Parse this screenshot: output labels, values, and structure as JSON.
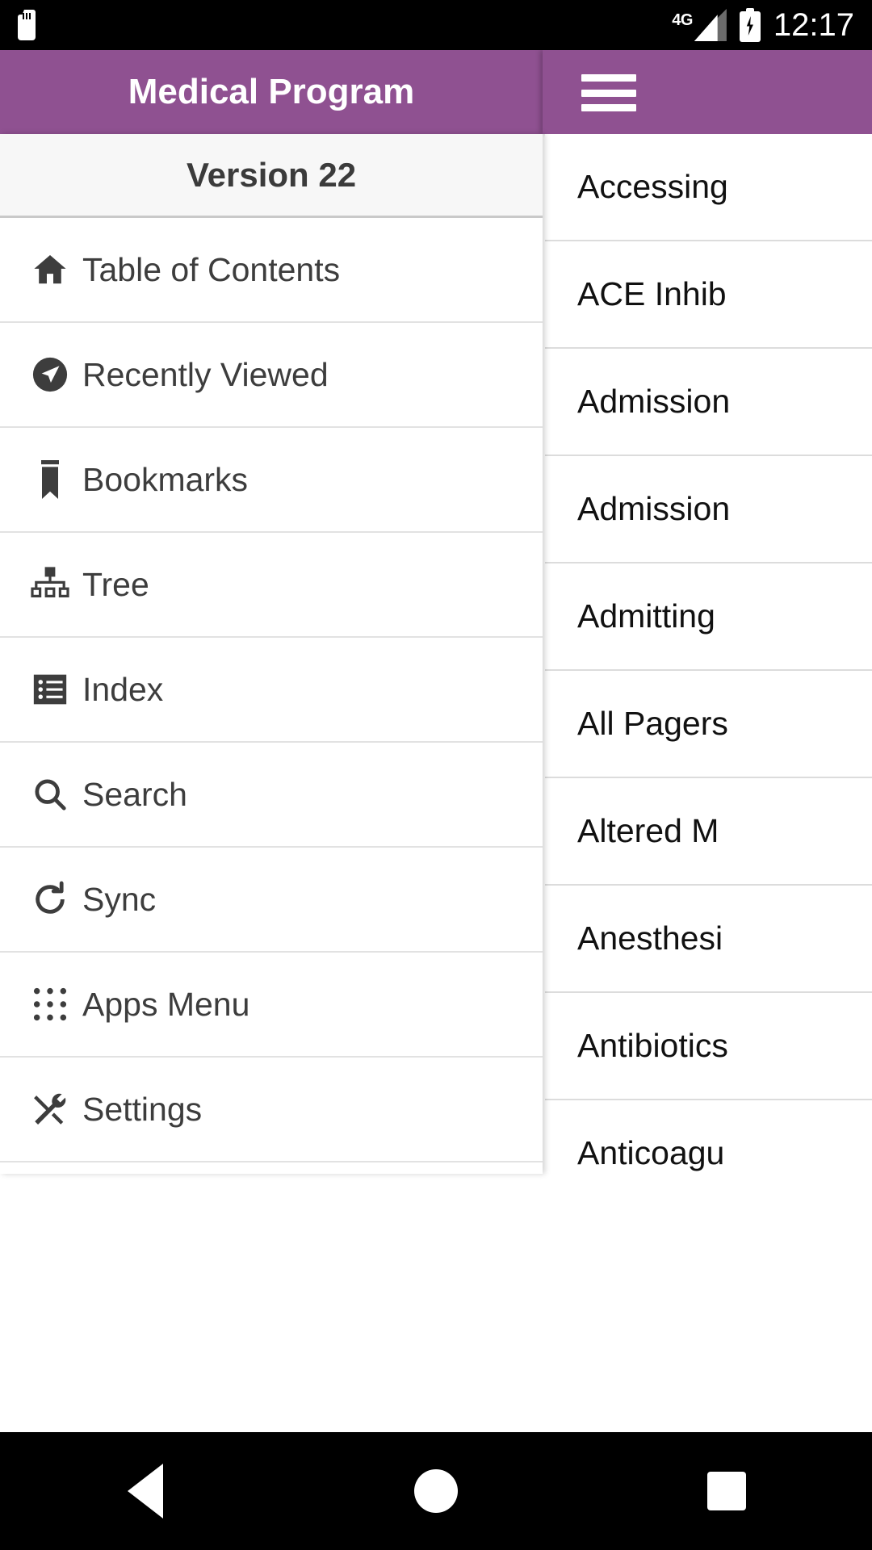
{
  "theme": {
    "accent": "#8f5191",
    "appbar_text": "#ffffff",
    "drawer_header_bg": "#f7f7f7",
    "text_primary": "#3d3d3d",
    "list_text": "#111111",
    "divider": "#e2e2e2",
    "statusbar_bg": "#000000",
    "navbar_bg": "#000000"
  },
  "statusbar": {
    "sd_card_icon": "sd-card-icon",
    "network_label": "4G",
    "signal_icon": "signal-bars-icon",
    "battery_icon": "battery-charging-icon",
    "time": "12:17"
  },
  "appbar": {
    "title": "Medical Program",
    "menu_icon": "hamburger-menu-icon"
  },
  "drawer": {
    "header": "Version 22",
    "items": [
      {
        "label": "Table of Contents",
        "icon": "home-icon"
      },
      {
        "label": "Recently Viewed",
        "icon": "location-arrow-icon"
      },
      {
        "label": "Bookmarks",
        "icon": "bookmark-icon"
      },
      {
        "label": "Tree",
        "icon": "sitemap-icon"
      },
      {
        "label": "Index",
        "icon": "list-icon"
      },
      {
        "label": "Search",
        "icon": "search-icon"
      },
      {
        "label": "Sync",
        "icon": "refresh-icon"
      },
      {
        "label": "Apps Menu",
        "icon": "grid-dots-icon"
      },
      {
        "label": "Settings",
        "icon": "tools-icon"
      }
    ]
  },
  "content_list": {
    "rows": [
      {
        "label": "Accessing"
      },
      {
        "label": "ACE Inhib"
      },
      {
        "label": "Admission"
      },
      {
        "label": "Admission"
      },
      {
        "label": "Admitting"
      },
      {
        "label": "All Pagers"
      },
      {
        "label": "Altered M"
      },
      {
        "label": "Anesthesi"
      },
      {
        "label": "Antibiotics"
      },
      {
        "label": "Anticoagu"
      }
    ]
  },
  "navbar": {
    "back_label": "back-button",
    "home_label": "home-button",
    "recents_label": "recents-button"
  }
}
